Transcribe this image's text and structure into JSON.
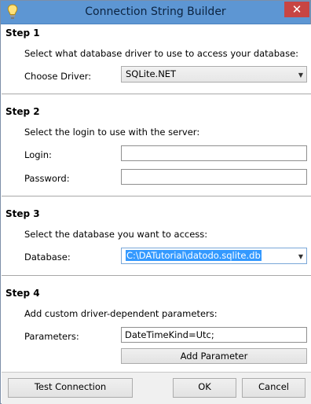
{
  "window": {
    "title": "Connection String Builder",
    "close": "✕"
  },
  "step1": {
    "heading": "Step 1",
    "description": "Select what database driver to use to access your database:",
    "driver_label": "Choose Driver:",
    "driver_value": "SQLite.NET"
  },
  "step2": {
    "heading": "Step 2",
    "description": "Select the login to use with the server:",
    "login_label": "Login:",
    "login_value": "",
    "password_label": "Password:",
    "password_value": ""
  },
  "step3": {
    "heading": "Step 3",
    "description": "Select the database you want to access:",
    "database_label": "Database:",
    "database_value": "C:\\DATutorial\\datodo.sqlite.db"
  },
  "step4": {
    "heading": "Step 4",
    "description": "Add custom driver-dependent parameters:",
    "parameters_label": "Parameters:",
    "parameters_value": "DateTimeKind=Utc;",
    "add_parameter": "Add Parameter"
  },
  "footer": {
    "test_connection": "Test Connection",
    "ok": "OK",
    "cancel": "Cancel"
  },
  "icons": {
    "app": "lightbulb-icon",
    "dropdown": "chevron-down-icon"
  }
}
